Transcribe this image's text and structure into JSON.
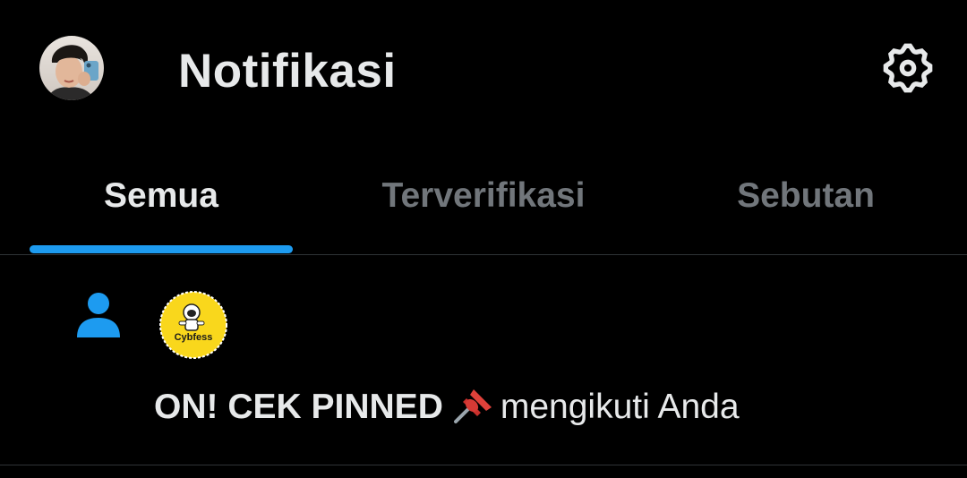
{
  "header": {
    "title": "Notifikasi",
    "avatar_icon": "user-avatar-photo",
    "settings_icon": "gear-icon"
  },
  "tabs": [
    {
      "label": "Semua",
      "active": true
    },
    {
      "label": "Terverifikasi",
      "active": false
    },
    {
      "label": "Sebutan",
      "active": false
    }
  ],
  "notifications": [
    {
      "type_icon": "person-follow-icon",
      "actor_avatar_text": "Cybfess",
      "actor_name": "ON! CEK PINNED",
      "emoji": "pushpin-icon",
      "action_text": "mengikuti Anda"
    }
  ],
  "colors": {
    "background": "#000000",
    "text_primary": "#e7e9ea",
    "text_secondary": "#71767b",
    "accent": "#1d9bf0",
    "divider": "#2f3336",
    "avatar_yellow": "#f9d71c"
  }
}
